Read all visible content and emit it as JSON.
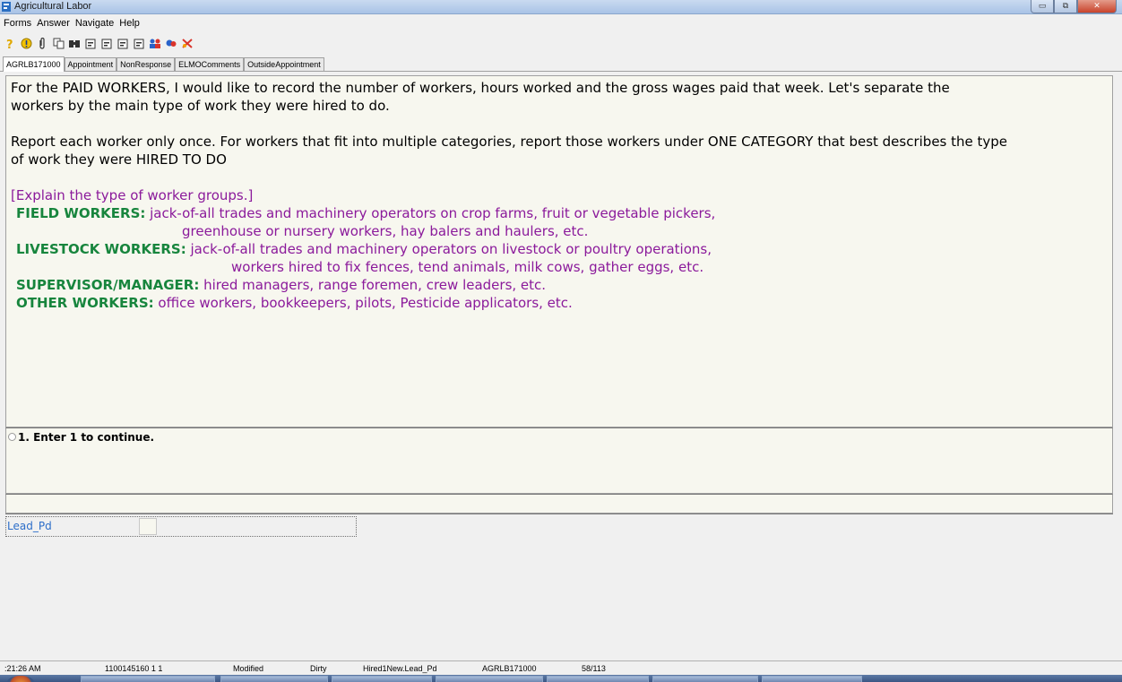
{
  "window": {
    "title": "Agricultural Labor"
  },
  "window_controls": {
    "minimize": "▭",
    "maximize": "⧉",
    "close": "✕"
  },
  "menu": [
    "Forms",
    "Answer",
    "Navigate",
    "Help"
  ],
  "toolbar_icons": [
    "help-question-icon",
    "info-icon",
    "attach-icon",
    "copy-icon",
    "find-icon",
    "form1-icon",
    "form2-icon",
    "form3-icon",
    "form4-icon",
    "users-icon",
    "sync-icon",
    "exit-icon"
  ],
  "tabs": [
    "AGRLB171000",
    "Appointment",
    "NonResponse",
    "ELMOComments",
    "OutsideAppointment"
  ],
  "question": {
    "para1_line1": " For the PAID WORKERS, I would like to record the number of workers, hours worked and the gross wages paid that week. Let's separate the",
    "para1_line2": "workers by the main type of work they were hired to do.",
    "para2_line1": "Report each worker only once. For workers that fit into multiple categories, report those workers under ONE CATEGORY that best describes the type",
    "para2_line2": "of work they were HIRED TO DO",
    "instruction": "[Explain the type of worker groups.]",
    "categories": [
      {
        "label": "FIELD WORKERS:",
        "line1": " jack-of-all trades and machinery operators on crop farms, fruit or vegetable pickers,",
        "line2": "greenhouse or nursery workers, hay balers and haulers, etc."
      },
      {
        "label": "LIVESTOCK WORKERS:",
        "line1": " jack-of-all trades and machinery operators on livestock or poultry operations,",
        "line2": "workers hired to fix fences, tend animals, milk cows, gather eggs, etc."
      },
      {
        "label": "SUPERVISOR/MANAGER:",
        "line1": " hired managers, range foremen, crew leaders, etc."
      },
      {
        "label": "OTHER WORKERS:",
        "line1": " office workers, bookkeepers, pilots, Pesticide applicators, etc."
      }
    ]
  },
  "answer": {
    "option_label": "1. Enter 1 to continue."
  },
  "field": {
    "name": "Lead_Pd",
    "value": ""
  },
  "status": {
    "time": ":21:26 AM",
    "case_id": "1100145160 1 1",
    "modified": "Modified",
    "dirty": "Dirty",
    "field_path": "Hired1New.Lead_Pd",
    "form": "AGRLB171000",
    "page": "58/113"
  },
  "colors": {
    "question_bg": "#f7f7ef",
    "instruction": "#8b1a9b",
    "category_label": "#17853d",
    "field_label": "#2d6ec9"
  }
}
